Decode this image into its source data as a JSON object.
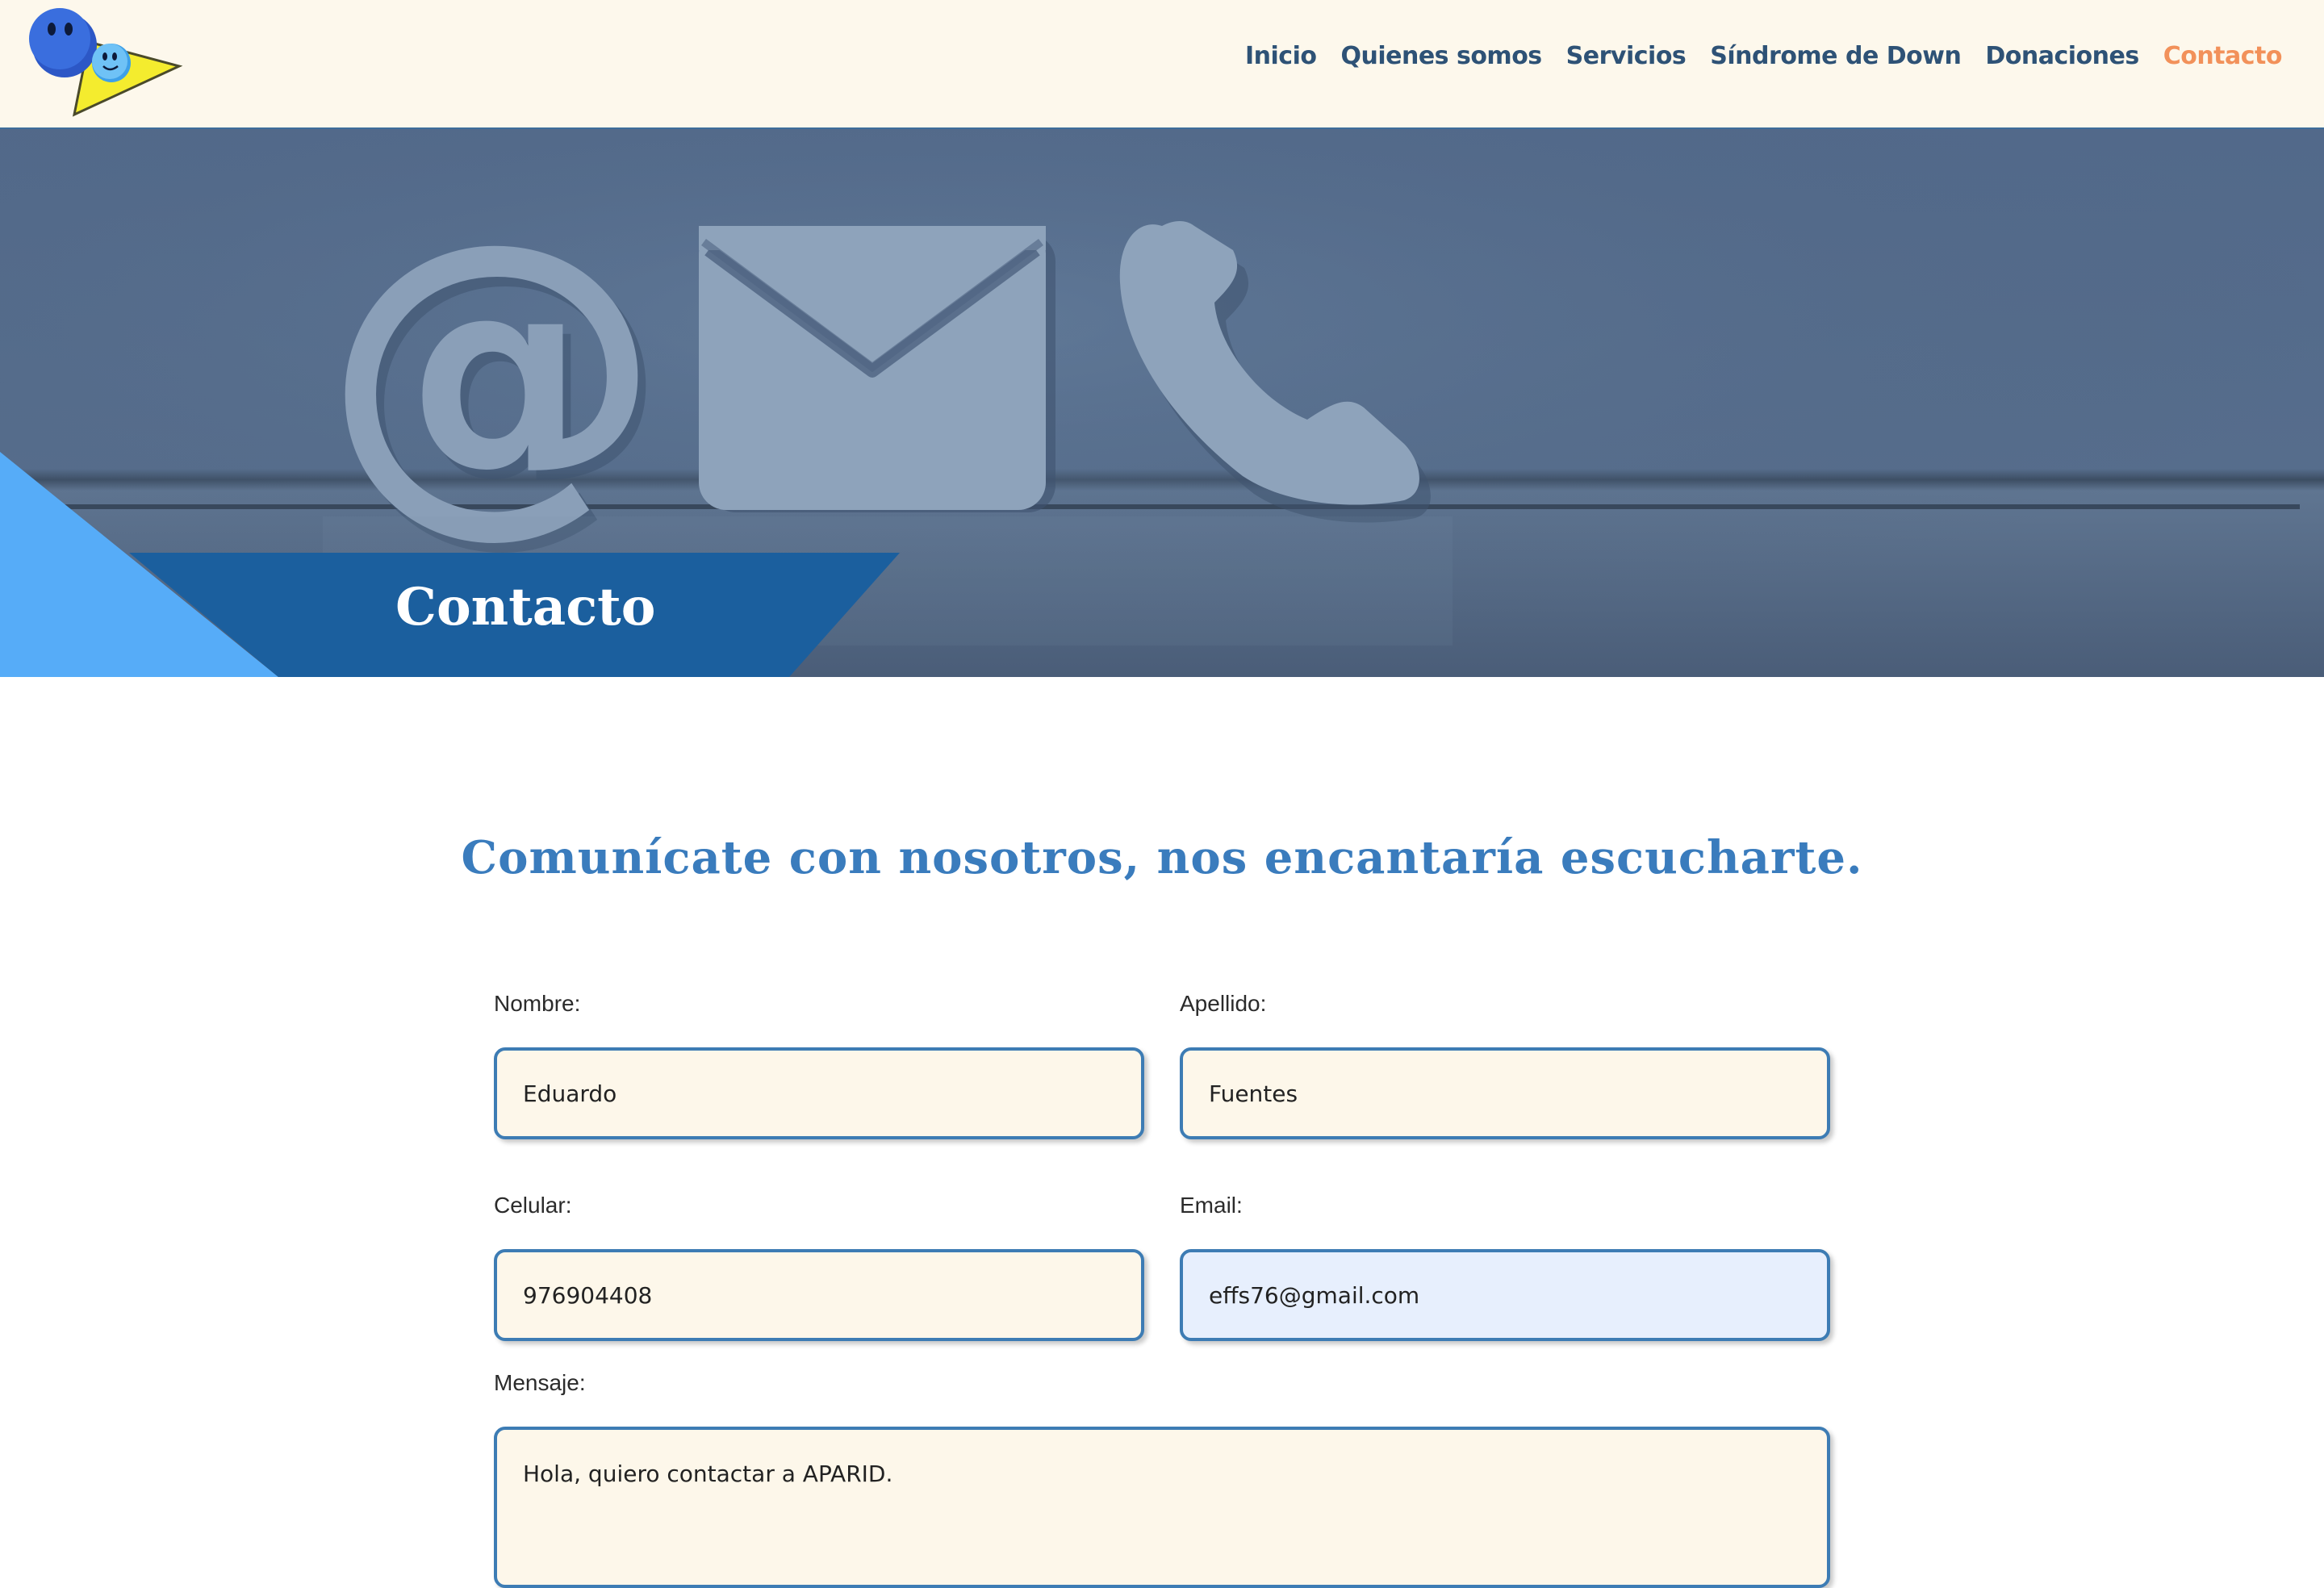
{
  "nav": {
    "items": [
      {
        "label": "Inicio",
        "active": false
      },
      {
        "label": "Quienes somos",
        "active": false
      },
      {
        "label": "Servicios",
        "active": false
      },
      {
        "label": "Síndrome de Down",
        "active": false
      },
      {
        "label": "Donaciones",
        "active": false
      },
      {
        "label": "Contacto",
        "active": true
      }
    ]
  },
  "hero": {
    "title": "Contacto"
  },
  "main": {
    "heading": "Comunícate con nosotros, nos encantaría escucharte."
  },
  "form": {
    "nombre": {
      "label": "Nombre:",
      "value": "Eduardo"
    },
    "apellido": {
      "label": "Apellido:",
      "value": "Fuentes"
    },
    "celular": {
      "label": "Celular:",
      "value": "976904408"
    },
    "email": {
      "label": "Email:",
      "value": "effs76@gmail.com"
    },
    "mensaje": {
      "label": "Mensaje:",
      "value": "Hola, quiero contactar a APARID."
    }
  },
  "colors": {
    "header_bg": "#fdf8ec",
    "nav_text": "#2e5276",
    "nav_active": "#f2915a",
    "accent_blue": "#3a7cbd",
    "banner_dark": "#1b5f9e",
    "banner_light": "#56acf8",
    "input_bg": "#fdf7ea",
    "input_border": "#3d7cb4"
  },
  "icons": [
    "logo-smiley-icon",
    "at-sign-icon",
    "envelope-icon",
    "phone-icon"
  ]
}
